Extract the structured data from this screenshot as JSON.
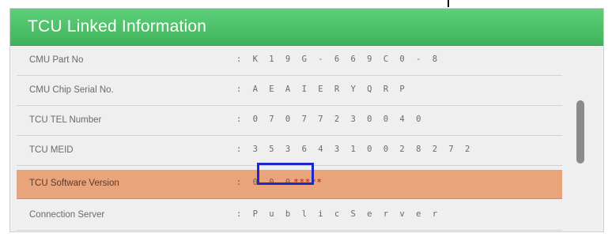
{
  "panel": {
    "title": "TCU Linked Information"
  },
  "rows": [
    {
      "label": "CMU Part No",
      "value": ": K 1 9 G - 6 6 9 C 0 - 8"
    },
    {
      "label": "CMU Chip Serial No.",
      "value": ": A E A I E R Y Q R P"
    },
    {
      "label": "TCU TEL Number",
      "value": ": 0 7 0 7 7 2 3 0 0 4 0"
    },
    {
      "label": "TCU MEID",
      "value": ": 3 5 3 6 4 3 1 0 0 2 8 2 7 2"
    },
    {
      "label": "TCU Software Version",
      "value_prefix": ": 0 0 0",
      "value_masked": "*****"
    },
    {
      "label": "Connection Server",
      "value": ": P u b l i c   S e r v e r"
    }
  ],
  "colors": {
    "header_green": "#4cc067",
    "highlight_orange": "#e9a47b",
    "mask_outline_blue": "#1e28c8"
  }
}
